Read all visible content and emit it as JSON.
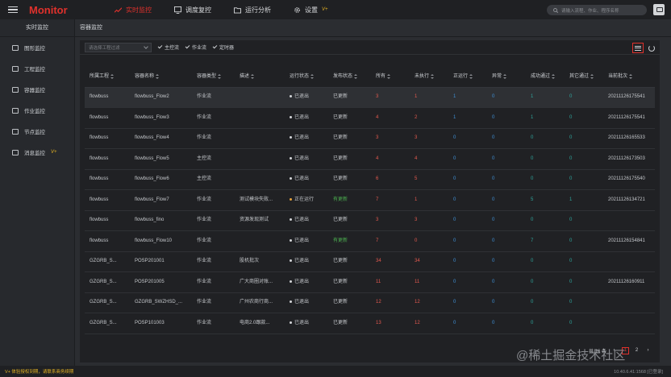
{
  "header": {
    "brand": "Monitor",
    "nav": [
      {
        "label": "实时监控",
        "icon": "trend-icon",
        "active": true
      },
      {
        "label": "调度复控",
        "icon": "monitor-icon",
        "active": false
      },
      {
        "label": "运行分析",
        "icon": "folder-icon",
        "active": false
      },
      {
        "label": "设置",
        "icon": "gear-icon",
        "active": false,
        "badge": "V+"
      }
    ],
    "search_placeholder": "请输入流程、作业、程序名称",
    "accent_color": "#e0312c"
  },
  "sidebar": {
    "heading": "实时监控",
    "items": [
      {
        "label": "图形监控",
        "icon": "monitor-icon"
      },
      {
        "label": "工程监控",
        "icon": "grid-icon"
      },
      {
        "label": "容器监控",
        "icon": "list-icon"
      },
      {
        "label": "作业监控",
        "icon": "list-icon"
      },
      {
        "label": "节点监控",
        "icon": "tree-icon"
      },
      {
        "label": "消息监控",
        "icon": "chat-icon",
        "badge": "V+"
      }
    ]
  },
  "breadcrumb": "容器监控",
  "toolbar": {
    "filter_placeholder": "请选择工程过滤",
    "checkboxes": [
      "主控流",
      "作业流",
      "定时器"
    ]
  },
  "table": {
    "columns": [
      "所属工程",
      "容器名称",
      "容器类型",
      "描述",
      "运行状态",
      "发布状态",
      "所有",
      "未执行",
      "正运行",
      "异常",
      "成功通过",
      "其它通过",
      "当前批次"
    ],
    "rows": [
      {
        "project": "flowbuss",
        "name": "flowbuss_Flow2",
        "type": "作业流",
        "desc": "",
        "status": "已退出",
        "pub": "已更新",
        "all": "3",
        "pending": "1",
        "running": "1",
        "error": "0",
        "success": "1",
        "other": "0",
        "batch": "20211126175541",
        "selected": true
      },
      {
        "project": "flowbuss",
        "name": "flowbuss_Flow3",
        "type": "作业流",
        "desc": "",
        "status": "已退出",
        "pub": "已更新",
        "all": "4",
        "pending": "2",
        "running": "1",
        "error": "0",
        "success": "1",
        "other": "0",
        "batch": "20211126175541"
      },
      {
        "project": "flowbuss",
        "name": "flowbuss_Flow4",
        "type": "作业流",
        "desc": "",
        "status": "已退出",
        "pub": "已更新",
        "all": "3",
        "pending": "3",
        "running": "0",
        "error": "0",
        "success": "0",
        "other": "0",
        "batch": "20211126165533"
      },
      {
        "project": "flowbuss",
        "name": "flowbuss_Flow5",
        "type": "主控流",
        "desc": "",
        "status": "已退出",
        "pub": "已更新",
        "all": "4",
        "pending": "4",
        "running": "0",
        "error": "0",
        "success": "0",
        "other": "0",
        "batch": "20211126173503"
      },
      {
        "project": "flowbuss",
        "name": "flowbuss_Flow6",
        "type": "主控流",
        "desc": "",
        "status": "已退出",
        "pub": "已更新",
        "all": "6",
        "pending": "5",
        "running": "0",
        "error": "0",
        "success": "0",
        "other": "0",
        "batch": "20211126175540"
      },
      {
        "project": "flowbuss",
        "name": "flowbuss_Flow7",
        "type": "作业流",
        "desc": "测试模块失败...",
        "status": "正在运行",
        "pub": "有更新",
        "all": "7",
        "pending": "1",
        "running": "0",
        "error": "0",
        "success": "5",
        "other": "1",
        "batch": "20211126134721",
        "running_state": true,
        "pub_pending": true
      },
      {
        "project": "flowbuss",
        "name": "flowbuss_fino",
        "type": "作业流",
        "desc": "资源发现测试",
        "status": "已退出",
        "pub": "已更新",
        "all": "3",
        "pending": "3",
        "running": "0",
        "error": "0",
        "success": "0",
        "other": "0",
        "batch": ""
      },
      {
        "project": "flowbuss",
        "name": "flowbuss_Flow10",
        "type": "作业流",
        "desc": "",
        "status": "已退出",
        "pub": "有更新",
        "all": "7",
        "pending": "0",
        "running": "0",
        "error": "0",
        "success": "7",
        "other": "0",
        "batch": "20211126154841",
        "pub_pending": true
      },
      {
        "project": "GZGRB_S...",
        "name": "POSP201001",
        "type": "作业流",
        "desc": "股机批次",
        "status": "已退出",
        "pub": "已更新",
        "all": "34",
        "pending": "34",
        "running": "0",
        "error": "0",
        "success": "0",
        "other": "0",
        "batch": ""
      },
      {
        "project": "GZGRB_S...",
        "name": "POSP201005",
        "type": "作业流",
        "desc": "广大商圈对账...",
        "status": "已退出",
        "pub": "已更新",
        "all": "11",
        "pending": "11",
        "running": "0",
        "error": "0",
        "success": "0",
        "other": "0",
        "batch": "20211126160911"
      },
      {
        "project": "GZGRB_S...",
        "name": "GZGRB_SWZHSD_...",
        "type": "作业流",
        "desc": "广州农商行商...",
        "status": "已退出",
        "pub": "已更新",
        "all": "12",
        "pending": "12",
        "running": "0",
        "error": "0",
        "success": "0",
        "other": "0",
        "batch": ""
      },
      {
        "project": "GZGRB_S...",
        "name": "POSP101003",
        "type": "作业流",
        "desc": "电商2.0跟款...",
        "status": "已退出",
        "pub": "已更新",
        "all": "13",
        "pending": "12",
        "running": "0",
        "error": "0",
        "success": "0",
        "other": "0",
        "batch": ""
      }
    ]
  },
  "pagination": {
    "total": "共 16 条",
    "current": "1",
    "next": "2"
  },
  "status_bar": {
    "left": "V+ 体验授权到期，请联系商务续期",
    "right": "10.40.6.41:1568 [已登录]"
  },
  "watermark": "@稀土掘金技术社区"
}
